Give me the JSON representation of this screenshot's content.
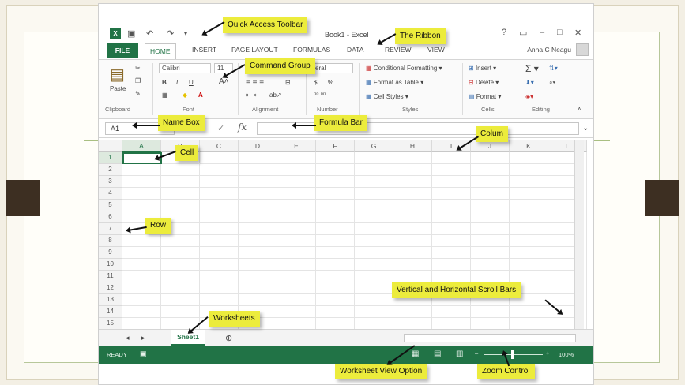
{
  "window": {
    "title": "Book1 - Excel"
  },
  "qat": {
    "icons": [
      "excel-logo-icon",
      "save-icon",
      "undo-icon",
      "redo-icon",
      "customize-icon"
    ]
  },
  "window_controls": [
    "help-icon",
    "ribbon-options-icon",
    "minimize-icon",
    "maximize-icon",
    "close-icon"
  ],
  "tabs": [
    "FILE",
    "HOME",
    "INSERT",
    "PAGE LAYOUT",
    "FORMULAS",
    "DATA",
    "REVIEW",
    "VIEW"
  ],
  "user": {
    "name": "Anna C Neagu"
  },
  "ribbon": {
    "paste": "Paste",
    "font_name": "Calibri",
    "font_size": "11",
    "number_format": "eral",
    "bold": "B",
    "italic": "I",
    "underline": "U",
    "percent": "%",
    "currency": "$",
    "styles": [
      "Conditional Formatting",
      "Format as Table",
      "Cell Styles"
    ],
    "cells": [
      "Insert",
      "Delete",
      "Format"
    ],
    "group_labels": [
      "Clipboard",
      "Font",
      "Alignment",
      "Number",
      "Styles",
      "Cells",
      "Editing"
    ]
  },
  "formula_bar": {
    "name_box": "A1",
    "fx": "fx",
    "value": ""
  },
  "grid": {
    "columns": [
      "A",
      "B",
      "C",
      "D",
      "E",
      "F",
      "G",
      "H",
      "I",
      "J",
      "K",
      "L"
    ],
    "rows": [
      "1",
      "2",
      "3",
      "4",
      "5",
      "6",
      "7",
      "8",
      "9",
      "10",
      "11",
      "12",
      "13",
      "14",
      "15"
    ],
    "active_cell": "A1"
  },
  "sheets": {
    "active": "Sheet1"
  },
  "status": {
    "mode": "READY",
    "zoom": "100%"
  },
  "callouts": {
    "quick_access": "Quick Access Toolbar",
    "ribbon": "The Ribbon",
    "command_group": "Command Group",
    "name_box": "Name Box",
    "formula_bar": "Formula Bar",
    "column": "Colum",
    "cell": "Cell",
    "row": "Row",
    "scroll_bars": "Vertical and Horizontal Scroll Bars",
    "worksheets": "Worksheets",
    "view_option": "Worksheet View Option",
    "zoom_control": "Zoom Control"
  },
  "colors": {
    "excel_green": "#217346",
    "callout_yellow": "#ecec3c"
  }
}
